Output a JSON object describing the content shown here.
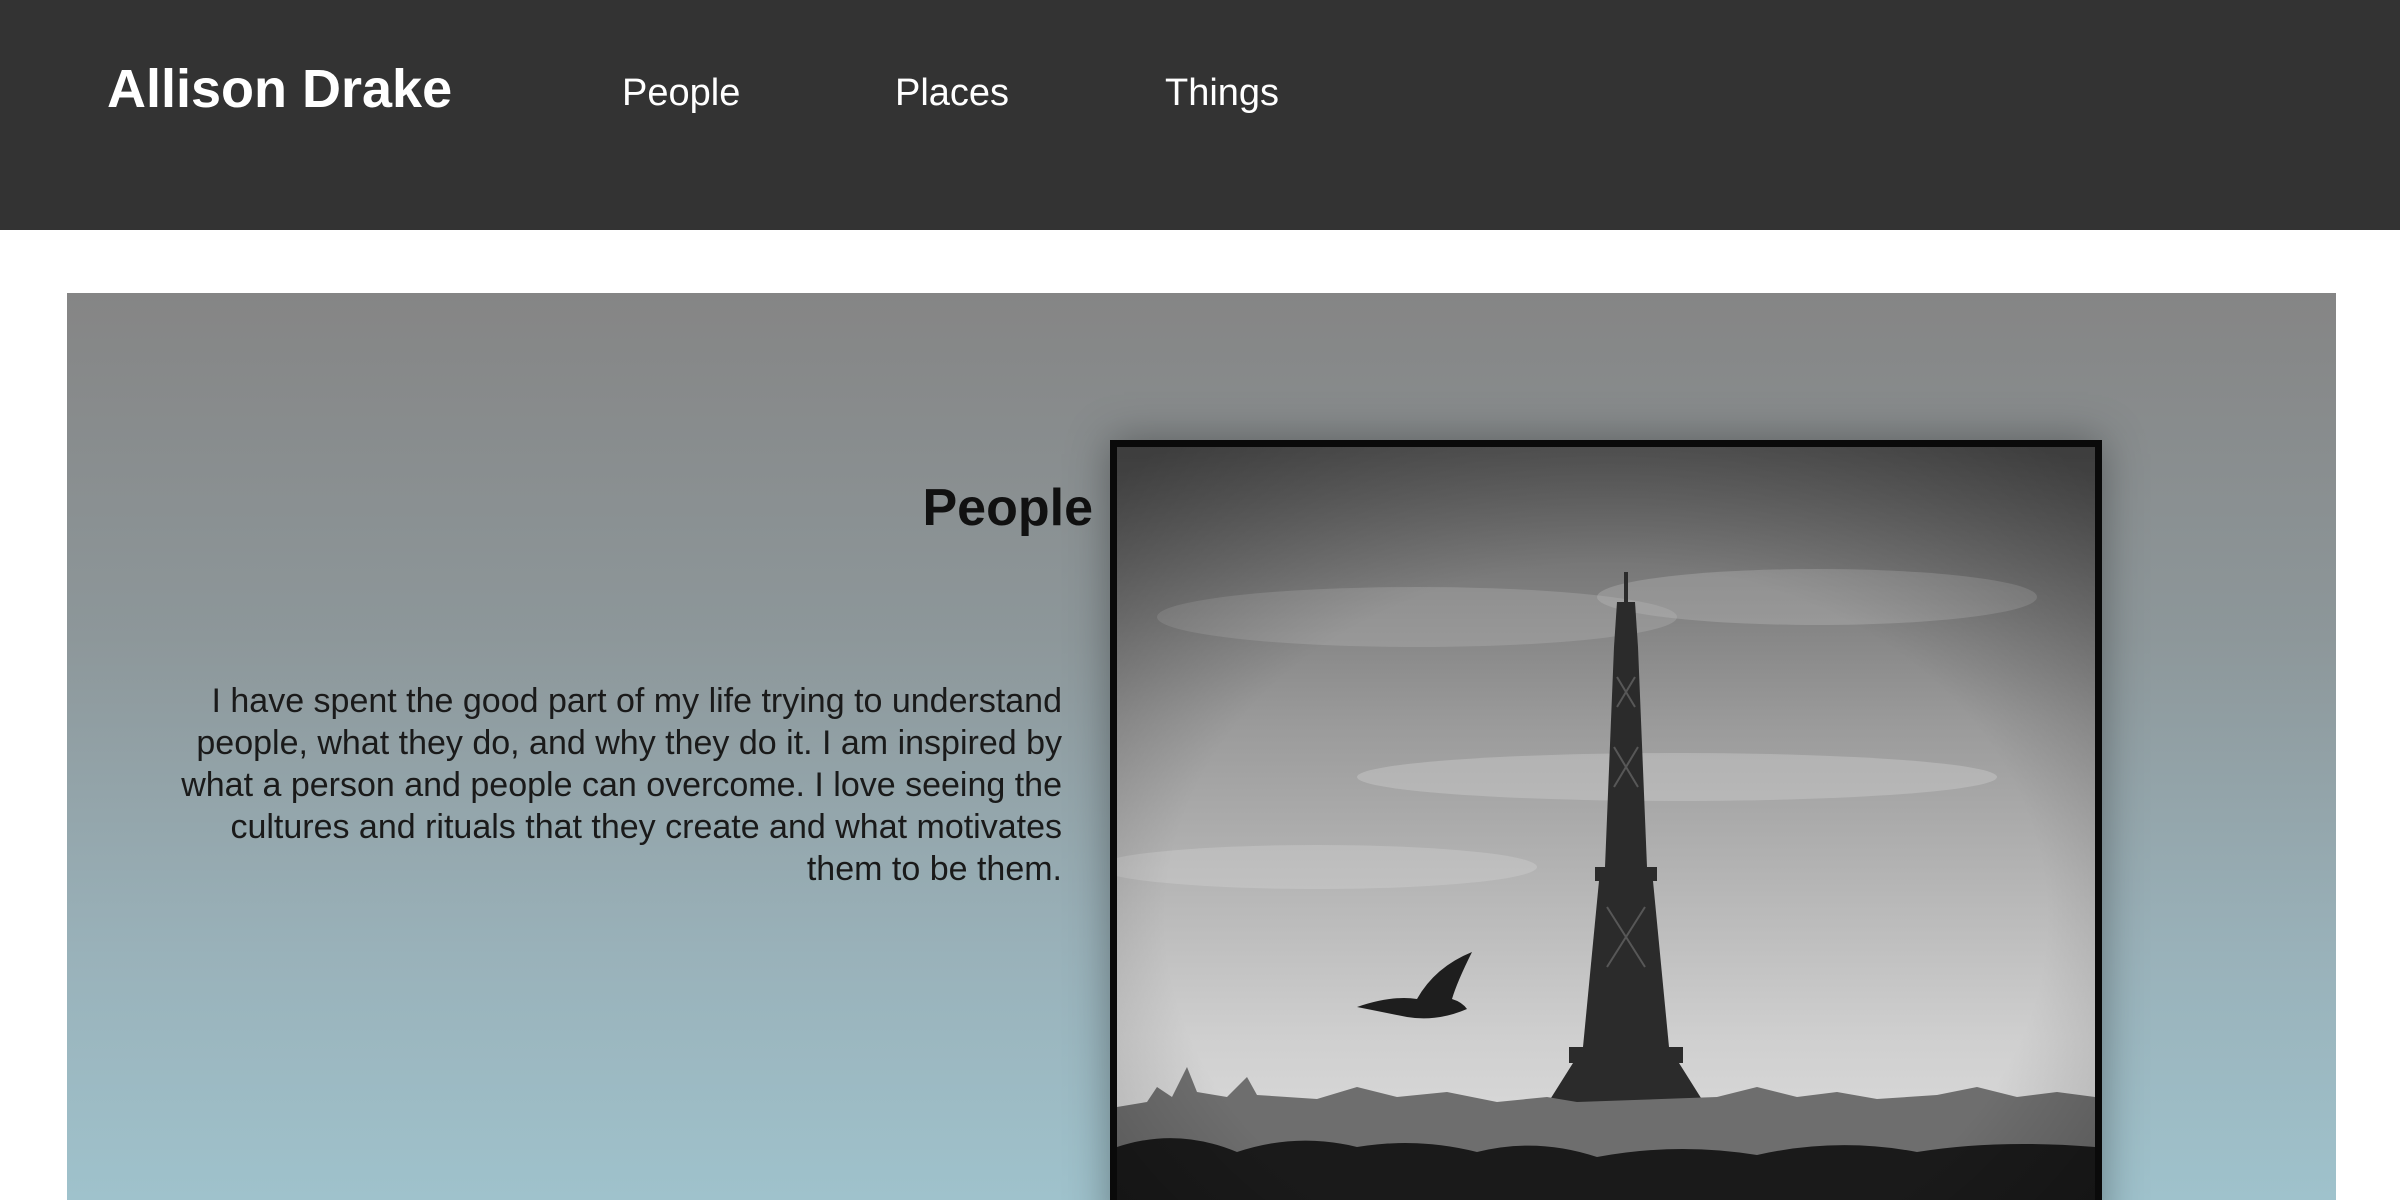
{
  "header": {
    "brand": "Allison Drake",
    "nav": [
      {
        "label": "People"
      },
      {
        "label": "Places"
      },
      {
        "label": "Things"
      }
    ]
  },
  "section": {
    "title": "People",
    "text": "I have spent the good part of my life trying to understand people, what they do, and why they do it. I am inspired by what a person and people can overcome. I love seeing the cultures and rituals that they create and what motivates them to be them."
  },
  "colors": {
    "header_bg": "#333333",
    "hero_top": "#858585",
    "hero_bottom": "#9fc2cc"
  },
  "image": {
    "icon": "eiffel-tower-photo"
  }
}
